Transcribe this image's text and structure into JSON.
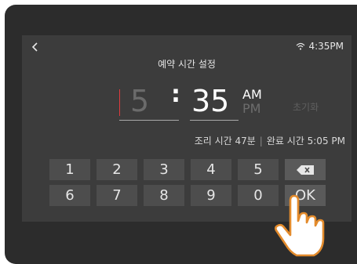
{
  "status_bar": {
    "time": "4:35PM",
    "back_icon": "chevron-left-icon",
    "wifi_icon": "wifi-icon"
  },
  "title": "예약 시간 설정",
  "time_picker": {
    "hour": "5",
    "separator": ":",
    "minute": "35",
    "am_label": "AM",
    "pm_label": "PM",
    "selected_period": "AM",
    "reset_label": "초기화"
  },
  "info": {
    "cook_time": "조리 시간 47분",
    "divider": "|",
    "end_time": "완료 시간 5:05 PM"
  },
  "keypad": {
    "row1": [
      "1",
      "2",
      "3",
      "4",
      "5"
    ],
    "row2": [
      "6",
      "7",
      "8",
      "9",
      "0"
    ],
    "delete_icon": "backspace-icon",
    "ok_label": "OK"
  },
  "overlay": {
    "icon": "pointing-hand-icon"
  },
  "colors": {
    "bezel": "#2c2c2c",
    "screen_bg": "#3c3c3c",
    "key_bg": "#4d4d4d",
    "cursor": "#e03a3e",
    "inactive_text": "#6b6b6b"
  }
}
